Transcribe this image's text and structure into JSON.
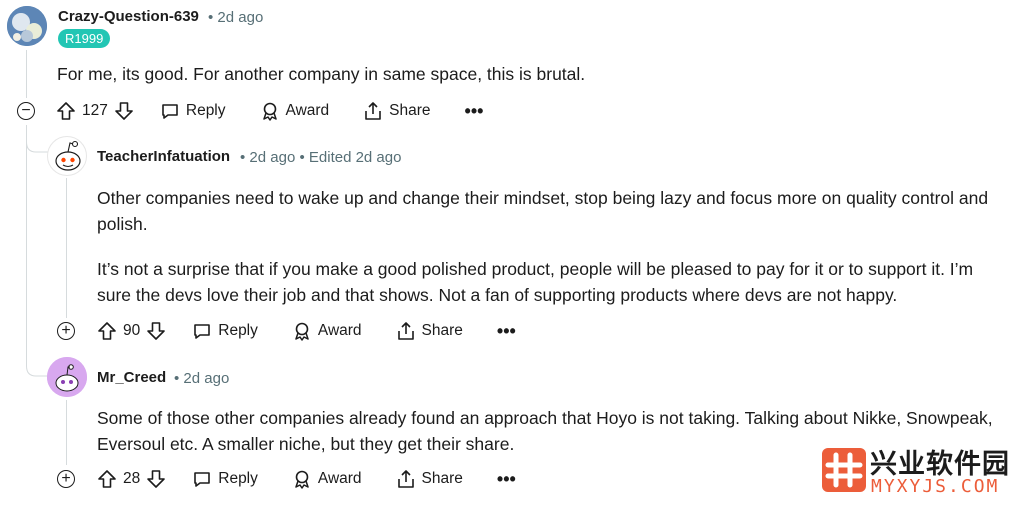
{
  "comments": [
    {
      "author": "Crazy-Question-639",
      "time": "• 2d ago",
      "flair": "R1999",
      "paragraphs": [
        "For me, its good. For another company in same space, this is brutal."
      ],
      "votes": "127",
      "toggle": "−"
    },
    {
      "author": "TeacherInfatuation",
      "time": "• 2d ago • Edited 2d ago",
      "paragraphs": [
        "Other companies need to wake up and change their mindset, stop being lazy and focus more on quality control and polish.",
        "It’s not a surprise that if you make a good polished product, people will be pleased to pay for it or to support it. I’m sure the devs love their job and that shows. Not a fan of supporting products where devs are not happy."
      ],
      "votes": "90",
      "toggle": "+"
    },
    {
      "author": "Mr_Creed",
      "time": "• 2d ago",
      "paragraphs": [
        "Some of those other companies already found an approach that Hoyo is not taking. Talking about Nikke, Snowpeak, Eversoul etc. A smaller niche, but they get their share."
      ],
      "votes": "28",
      "toggle": "+"
    }
  ],
  "actions": {
    "reply": "Reply",
    "award": "Award",
    "share": "Share",
    "more": "•••"
  },
  "watermark": {
    "title": "兴业软件园",
    "sub": "MYXYJS.COM",
    "logo_color": "#ec5d3a"
  },
  "colors": {
    "flair": "#22c6b4",
    "meta": "#576f76",
    "line": "#d6dbdd"
  }
}
